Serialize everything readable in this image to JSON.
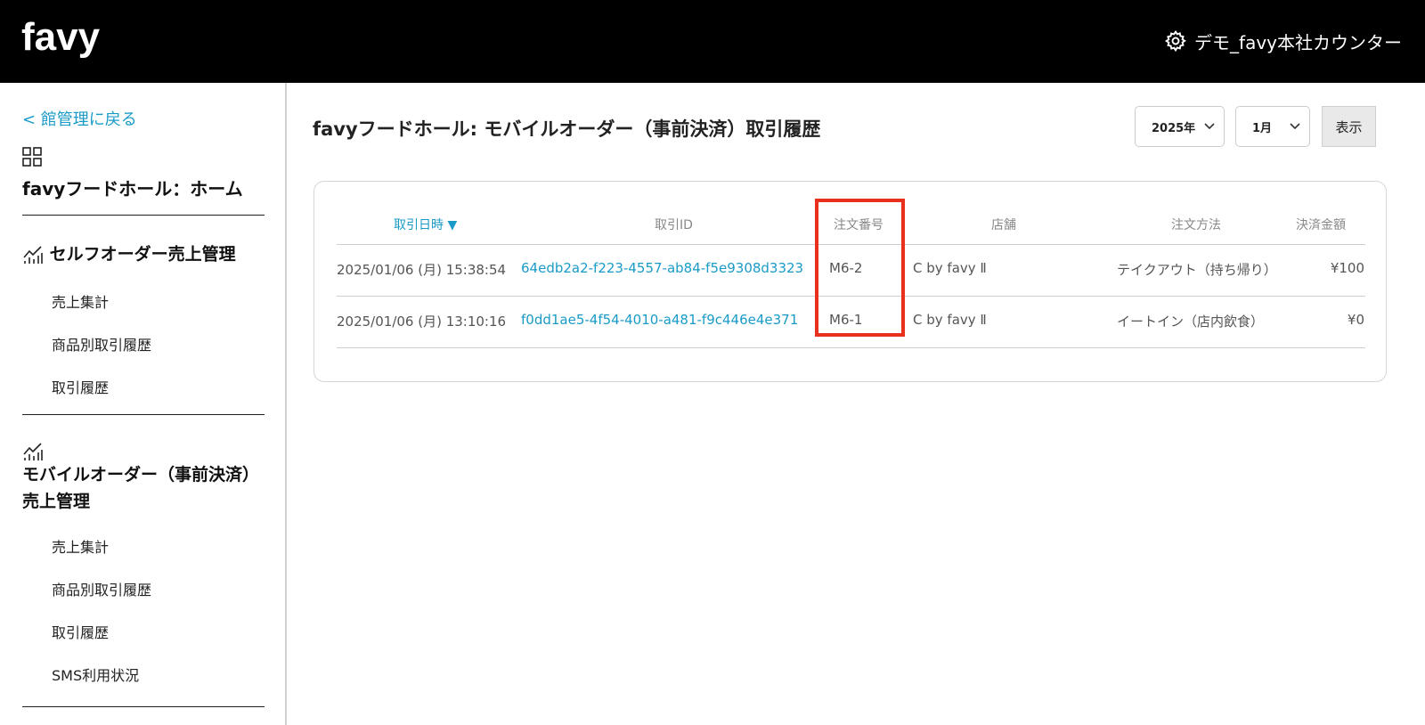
{
  "header": {
    "logo_text": "favy",
    "store_name": "デモ_favy本社カウンター",
    "icons": {
      "settings": "gear-icon"
    }
  },
  "sidebar": {
    "back_link": "< 館管理に戻る",
    "home_label": "favyフードホール：ホーム",
    "sections": [
      {
        "title": "セルフオーダー売上管理",
        "items": [
          "売上集計",
          "商品別取引履歴",
          "取引履歴"
        ]
      },
      {
        "title_line1": "モバイルオーダー（事前決済）",
        "title_line2": "売上管理",
        "items": [
          "売上集計",
          "商品別取引履歴",
          "取引履歴",
          "SMS利用状況"
        ]
      }
    ]
  },
  "main": {
    "title": "favyフードホール: モバイルオーダー（事前決済）取引履歴",
    "year_select": "2025年",
    "month_select": "1月",
    "show_button": "表示",
    "table": {
      "columns": [
        "取引日時 ▼",
        "取引ID",
        "注文番号",
        "店舗",
        "注文方法",
        "決済金額"
      ],
      "rows": [
        [
          "2025/01/06 (月) 15:38:54",
          "64edb2a2-f223-4557-ab84-f5e9308d3323",
          "M6-2",
          "C by favy Ⅱ",
          "テイクアウト（持ち帰り）",
          "¥100"
        ],
        [
          "2025/01/06 (月) 13:10:16",
          "f0dd1ae5-4f54-4010-a481-f9c446e4e371",
          "M6-1",
          "C by favy Ⅱ",
          "イートイン（店内飲食）",
          "¥0"
        ]
      ]
    },
    "highlight_color": "#e8301c",
    "accent_color": "#1a9bc7"
  }
}
